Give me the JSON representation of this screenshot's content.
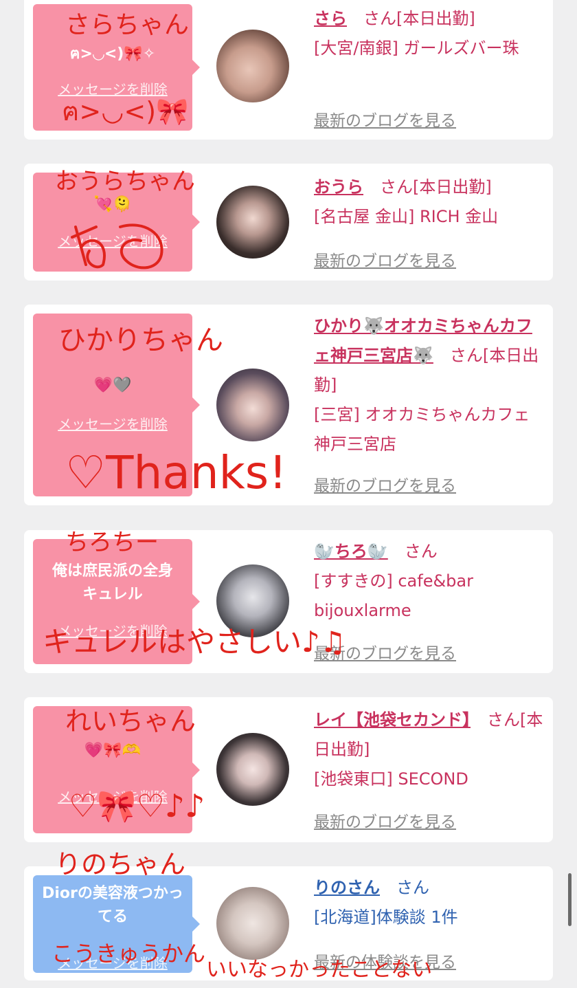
{
  "cards": [
    {
      "bubble_text": "ฅ>◡<)🎀✧",
      "delete_label": "メッセージを削除",
      "name": "さら",
      "san": "さん",
      "status": "[本日出勤]",
      "area_shop": "[大宮/南銀] ガールズバー珠",
      "link": "最新のブログを見る"
    },
    {
      "bubble_text": "💘🫠",
      "delete_label": "メッセージを削除",
      "name": "おうら",
      "san": "さん",
      "status": "[本日出勤]",
      "area_shop": "[名古屋 金山] RICH 金山",
      "link": "最新のブログを見る"
    },
    {
      "bubble_text": "💗🩶",
      "delete_label": "メッセージを削除",
      "name": "ひかり🐺オオカミちゃんカフェ神戸三宮店🐺",
      "san": "さん",
      "status": "[本日出勤]",
      "area_shop": "[三宮] オオカミちゃんカフェ神戸三宮店",
      "link": "最新のブログを見る"
    },
    {
      "bubble_text": "俺は庶民派の全身キュレル",
      "delete_label": "メッセージを削除",
      "name": "🦭ちろ🦭",
      "san": "さん",
      "status": "",
      "area_shop": "[すすきの] cafe&bar bijouxlarme",
      "link": "最新のブログを見る"
    },
    {
      "bubble_text": "💗🎀🫶",
      "delete_label": "メッセージを削除",
      "name": "レイ【池袋セカンド】",
      "san": "さん",
      "status": "[本日出勤]",
      "area_shop": "[池袋東口] SECOND",
      "link": "最新のブログを見る"
    },
    {
      "bubble_text": "Diorの美容液つかってる",
      "delete_label": "メッセージを削除",
      "name": "りのさん",
      "san": "さん",
      "status": "",
      "area_shop": "[北海道]体験談 1件",
      "link": "最新の体験談を見る"
    }
  ],
  "annotations": [
    "さらちゃん",
    "ฅ>◡<)🎀",
    "おうらちゃん",
    "ひかりちゃん",
    "♡Thanks!",
    "ちろちー",
    "キュレルはやさしい♪♫",
    "れいちゃん",
    "♡🎀♡♪♪",
    "りのちゃん",
    "こうきゅうかん",
    "いいなっかったことない"
  ],
  "colors": {
    "pink_bubble": "#f892a6",
    "blue_bubble": "#8db9f2",
    "pink_text": "#c8325e",
    "blue_text": "#2f62b0",
    "ink": "#e0231c"
  }
}
